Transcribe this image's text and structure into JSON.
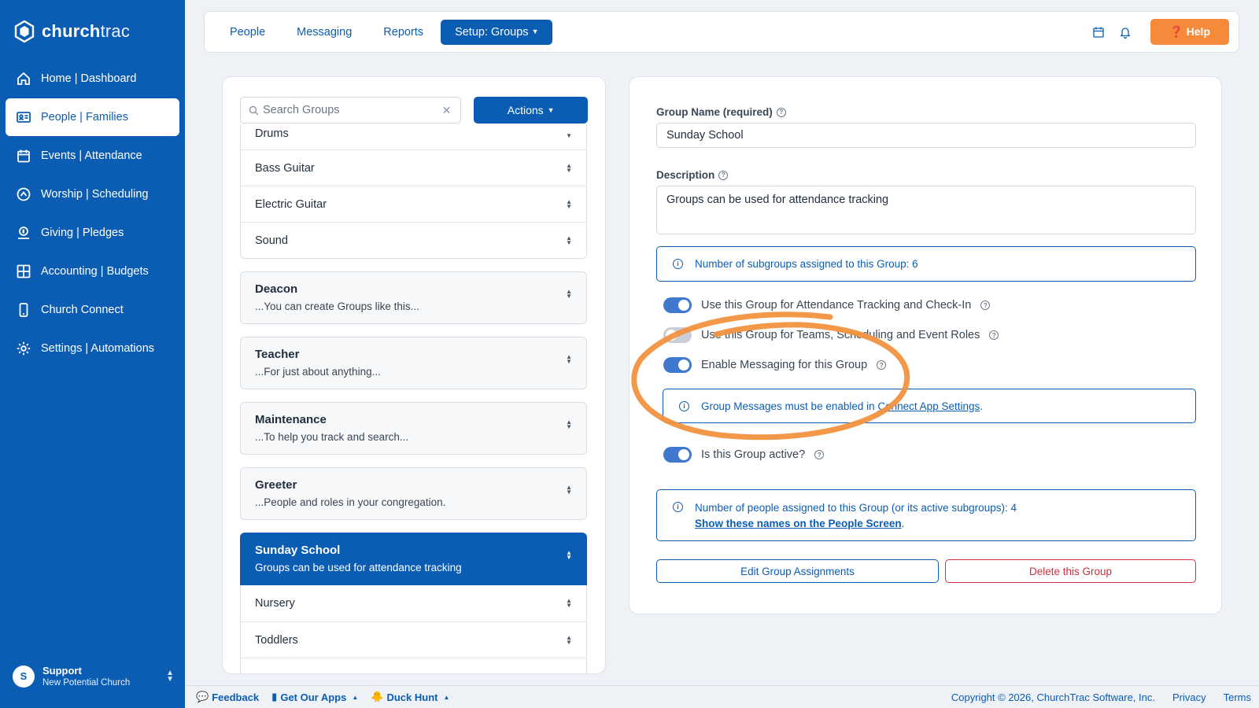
{
  "brand": {
    "name_bold": "church",
    "name_light": "trac"
  },
  "sidebar": {
    "items": [
      {
        "label": "Home | Dashboard",
        "icon": "home-icon",
        "active": false
      },
      {
        "label": "People | Families",
        "icon": "id-card-icon",
        "active": true
      },
      {
        "label": "Events | Attendance",
        "icon": "calendar-icon",
        "active": false
      },
      {
        "label": "Worship | Scheduling",
        "icon": "worship-icon",
        "active": false
      },
      {
        "label": "Giving | Pledges",
        "icon": "giving-icon",
        "active": false
      },
      {
        "label": "Accounting | Budgets",
        "icon": "grid-icon",
        "active": false
      },
      {
        "label": "Church Connect",
        "icon": "phone-icon",
        "active": false
      },
      {
        "label": "Settings | Automations",
        "icon": "gear-icon",
        "active": false
      }
    ],
    "user": {
      "initial": "S",
      "name": "Support",
      "church": "New Potential Church"
    }
  },
  "topbar": {
    "links": [
      "People",
      "Messaging",
      "Reports"
    ],
    "active_menu": "Setup: Groups",
    "help": "Help"
  },
  "groups_panel": {
    "search_placeholder": "Search Groups",
    "actions_label": "Actions",
    "top_subgroups": [
      "Drums",
      "Bass Guitar",
      "Electric Guitar",
      "Sound"
    ],
    "groups": [
      {
        "name": "Deacon",
        "desc": "...You can create Groups like this..."
      },
      {
        "name": "Teacher",
        "desc": "...For just about anything..."
      },
      {
        "name": "Maintenance",
        "desc": "...To help you track and search..."
      },
      {
        "name": "Greeter",
        "desc": "...People and roles in your congregation."
      }
    ],
    "selected": {
      "name": "Sunday School",
      "desc": "Groups can be used for attendance tracking"
    },
    "selected_subgroups": [
      "Nursery",
      "Toddlers"
    ]
  },
  "detail": {
    "name_label": "Group Name (required)",
    "name_value": "Sunday School",
    "desc_label": "Description",
    "desc_value": "Groups can be used for attendance tracking",
    "subgroups_info": "Number of subgroups assigned to this Group: 6",
    "toggles": {
      "attendance": "Use this Group for Attendance Tracking and Check-In",
      "teams": "Use this Group for Teams, Scheduling and Event Roles",
      "messaging": "Enable Messaging for this Group",
      "active": "Is this Group active?"
    },
    "messages_info_prefix": "Group Messages must be enabled in ",
    "messages_info_link": "Connect App Settings",
    "messages_info_suffix": ".",
    "people_info": "Number of people assigned to this Group (or its active subgroups): 4",
    "people_link": "Show these names on the People Screen",
    "people_link_suffix": ".",
    "edit_button": "Edit Group Assignments",
    "delete_button": "Delete this Group"
  },
  "footer": {
    "feedback": "Feedback",
    "apps": "Get Our Apps",
    "duck": "Duck Hunt",
    "copyright": "Copyright © 2026, ChurchTrac Software, Inc.",
    "privacy": "Privacy",
    "terms": "Terms"
  },
  "colors": {
    "primary": "#0b5db3",
    "accent": "#f48a3a",
    "danger": "#d0303a",
    "annotation": "#f2913f"
  }
}
